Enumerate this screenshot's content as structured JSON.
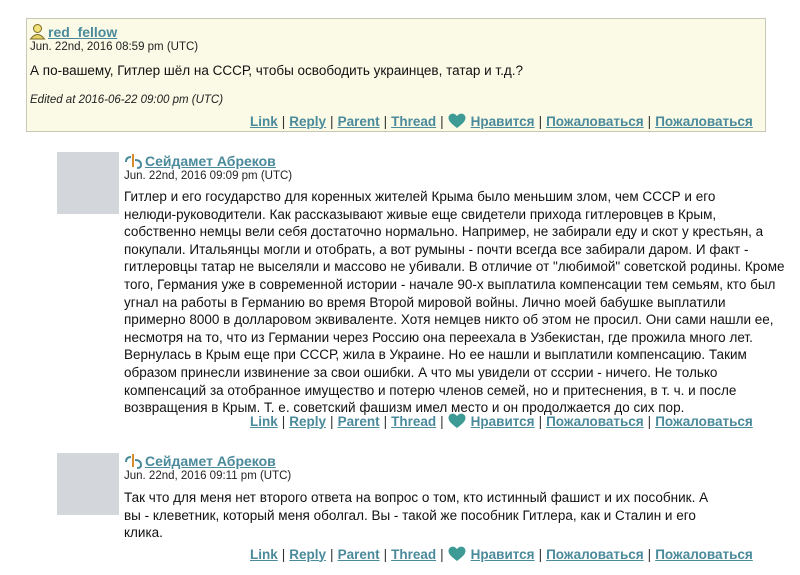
{
  "comment1": {
    "username": "red_fellow",
    "date": "Jun. 22nd, 2016 08:59 pm (UTC)",
    "text": "А по-вашему, Гитлер шёл на СССР, чтобы освободить украинцев, татар и т.д.?",
    "edited": "Edited at 2016-06-22 09:00 pm (UTC)"
  },
  "comment2": {
    "username": "Сейдамет Абреков",
    "date": "Jun. 22nd, 2016 09:09 pm (UTC)",
    "lines": [
      "Гитлер и его государство для коренных жителей Крыма было меньшим злом, чем СССР и его",
      "нелюди-руководители. Как рассказывают живые еще свидетели прихода гитлеровцев в Крым,",
      "собственно немцы вели себя достаточно нормально. Например, не забирали еду и скот у крестьян, а",
      "покупали. Итальянцы могли и отобрать, а вот румыны - почти всегда все забирали даром. И факт -",
      "гитлеровцы татар не выселяли и массово не убивали. В отличие от \"любимой\" советской родины. Кроме",
      "того, Германия уже в современной истории - начале 90-х выплатила компенсации тем семьям, кто был",
      "угнал на работы в Германию во время Второй мировой войны. Лично моей бабушке выплатили",
      "примерно 8000 в долларовом эквиваленте. Хотя немцев никто об этом не просил. Они сами нашли ее,",
      "несмотря на то, что из Германии через Россию она переехала в Узбекистан, где прожила много лет.",
      "Вернулась в Крым еще при СССР, жила в Украине. Но ее нашли и выплатили компенсацию. Таким",
      "образом принесли извинение за свои ошибки. А что мы увидели от сссрии - ничего. Не только",
      "компенсаций за отобранное имущество и потерю членов семей, но и притеснения, в т. ч. и после",
      "возвращения в Крым. Т. е. советский фашизм имел место и он продолжается до сих пор."
    ]
  },
  "comment3": {
    "username": "Сейдамет Абреков",
    "date": "Jun. 22nd, 2016 09:11 pm (UTC)",
    "lines": [
      "Так что для меня нет второго ответа на вопрос о том, кто истинный фашист и их пособник. А",
      "вы - клеветник, который меня оболгал. Вы - такой же пособник Гитлера, как и Сталин и его",
      "клика."
    ]
  },
  "actions": {
    "link": "Link",
    "reply": "Reply",
    "parent": "Parent",
    "thread": "Thread",
    "like": "Нравится",
    "report1": "Пожаловаться",
    "report2": "Пожаловаться",
    "separator": "|"
  },
  "colors": {
    "link": "#4a8a9b",
    "highlight_bg": "#fafae6",
    "heart": "#3d9a94"
  }
}
